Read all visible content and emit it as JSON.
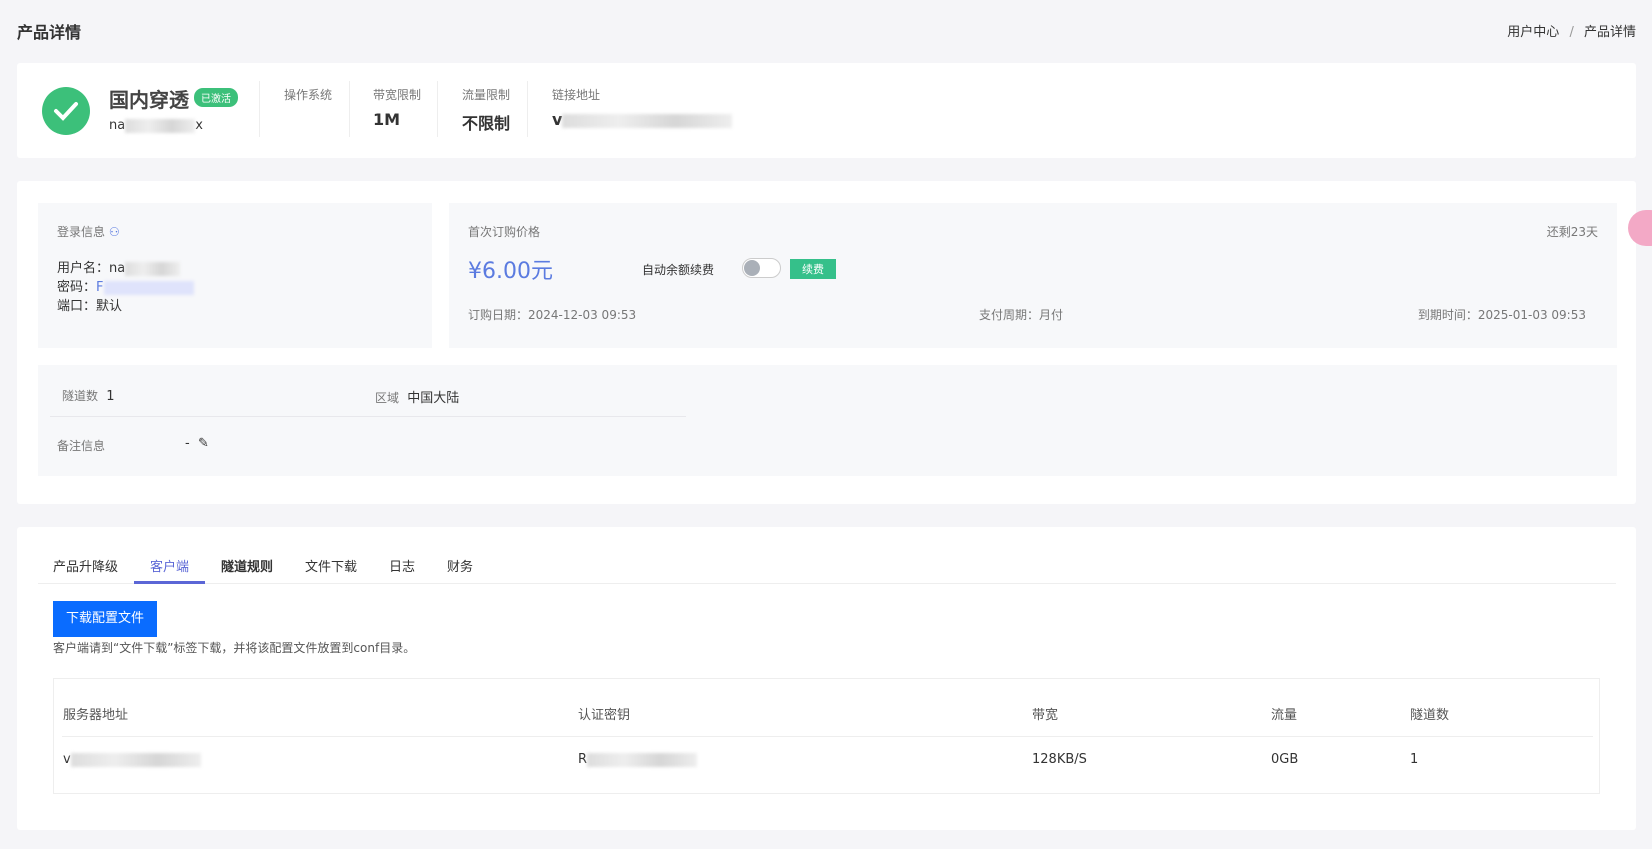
{
  "page": {
    "title": "产品详情",
    "breadcrumb": [
      "用户中心",
      "产品详情"
    ],
    "breadcrumb_sep": "/"
  },
  "product": {
    "name": "国内穿透",
    "status": "已激活",
    "id_prefix": "na",
    "id_suffix": "x",
    "status_color": "#3cc07a",
    "cols": [
      {
        "label": "操作系统",
        "value": ""
      },
      {
        "label": "带宽限制",
        "value": "1M"
      },
      {
        "label": "流量限制",
        "value": "不限制"
      },
      {
        "label": "链接地址",
        "value": "v"
      }
    ]
  },
  "login": {
    "title": "登录信息",
    "username_label": "用户名：",
    "username_prefix": "na",
    "password_label": "密码：",
    "password_prefix": "F",
    "port_label": "端口：",
    "port_value": "默认"
  },
  "price": {
    "title": "首次订购价格",
    "remaining": "还剩23天",
    "amount": "¥6.00元",
    "auto_renew_label": "自动余额续费",
    "auto_renew_on": false,
    "renew_button": "续费",
    "order_date": "订购日期：2024-12-03 09:53",
    "pay_cycle": "支付周期：月付",
    "expire": "到期时间：2025-01-03 09:53",
    "accent": "#5b7be0"
  },
  "tunnel": {
    "count_label": "隧道数",
    "count": "1",
    "region_label": "区域",
    "region": "中国大陆",
    "note_label": "备注信息",
    "note": "-"
  },
  "tabs": [
    {
      "label": "产品升降级"
    },
    {
      "label": "客户端",
      "active": true
    },
    {
      "label": "隧道规则"
    },
    {
      "label": "文件下载"
    },
    {
      "label": "日志"
    },
    {
      "label": "财务"
    }
  ],
  "client": {
    "download_button": "下载配置文件",
    "hint": "客户端请到“文件下载”标签下载，并将该配置文件放置到conf目录。",
    "headers": [
      "服务器地址",
      "认证密钥",
      "带宽",
      "流量",
      "隧道数"
    ],
    "row": {
      "server_prefix": "v",
      "key_prefix": "R",
      "bandwidth": "128KB/S",
      "traffic": "0GB",
      "tunnels": "1"
    }
  }
}
